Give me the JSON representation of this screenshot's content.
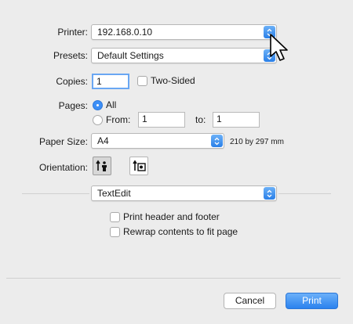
{
  "printer": {
    "label": "Printer:",
    "value": "192.168.0.10"
  },
  "presets": {
    "label": "Presets:",
    "value": "Default Settings"
  },
  "copies": {
    "label": "Copies:",
    "value": "1",
    "two_sided_label": "Two-Sided"
  },
  "pages": {
    "label": "Pages:",
    "all_label": "All",
    "from_label": "From:",
    "from_value": "1",
    "to_label": "to:",
    "to_value": "1",
    "selected": "All"
  },
  "paper_size": {
    "label": "Paper Size:",
    "value": "A4",
    "dimensions": "210 by 297 mm"
  },
  "orientation": {
    "label": "Orientation:",
    "selected": "portrait"
  },
  "app_panel": {
    "value": "TextEdit",
    "options": [
      "Print header and footer",
      "Rewrap contents to fit page"
    ]
  },
  "buttons": {
    "cancel": "Cancel",
    "print": "Print"
  },
  "colors": {
    "accent": "#2b82ee",
    "background": "#ececec"
  }
}
